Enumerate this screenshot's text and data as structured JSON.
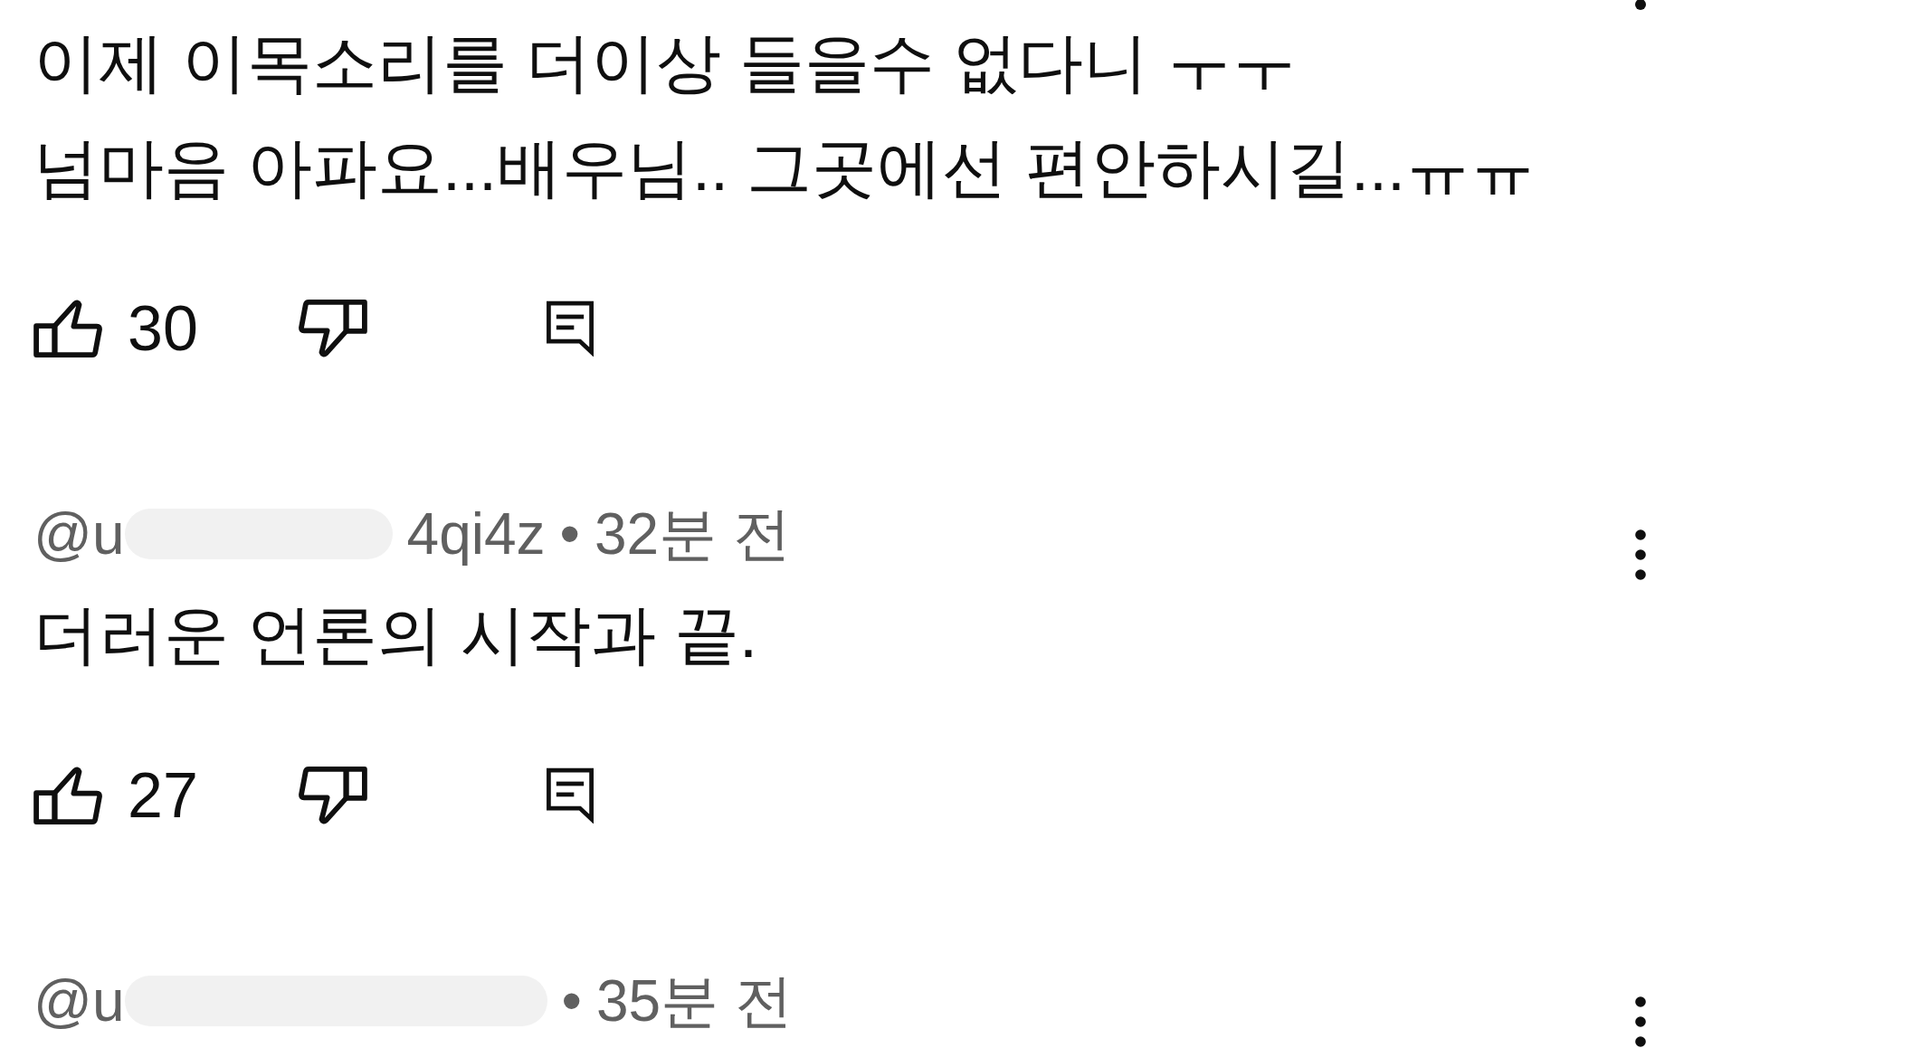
{
  "comments": [
    {
      "text": "이제 이목소리를 더이상 들을수 없다니 ㅜㅜ\n넘마음 아파요...배우님.. 그곳에선 편안하시길...ㅠㅠ",
      "likes": "30"
    },
    {
      "author_start": "@u",
      "author_end": "4qi4z",
      "separator": "•",
      "time": "32분 전",
      "text": "더러운 언론의 시작과 끝.",
      "likes": "27"
    },
    {
      "author_start": "@u",
      "separator": "•",
      "time": "35분 전"
    }
  ]
}
